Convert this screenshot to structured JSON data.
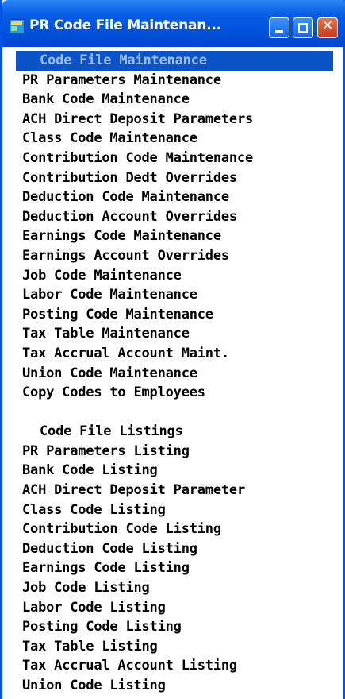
{
  "window": {
    "title": "PR Code File Maintenan...",
    "buttons": {
      "minimize": "minimize",
      "maximize": "maximize",
      "close": "✕"
    }
  },
  "menu": {
    "maintenance_header": "Code File Maintenance",
    "maintenance_items": [
      "PR Parameters Maintenance",
      "Bank Code Maintenance",
      "ACH Direct Deposit Parameters",
      "Class Code Maintenance",
      "Contribution Code Maintenance",
      "Contribution Dedt Overrides",
      "Deduction Code Maintenance",
      "Deduction Account Overrides",
      "Earnings Code Maintenance",
      "Earnings Account Overrides",
      "Job Code Maintenance",
      "Labor Code Maintenance",
      "Posting Code Maintenance",
      "Tax Table Maintenance",
      "Tax Accrual Account Maint.",
      "Union Code Maintenance",
      "Copy Codes to Employees"
    ],
    "listings_header": "Code File Listings",
    "listing_items": [
      "PR Parameters Listing",
      "Bank Code Listing",
      "ACH Direct Deposit Parameter",
      "Class Code Listing",
      "Contribution Code Listing",
      "Deduction Code Listing",
      "Earnings Code Listing",
      "Job Code Listing",
      "Labor Code Listing",
      "Posting Code Listing",
      "Tax Table Listing",
      "Tax Accrual Account Listing",
      "Union Code Listing"
    ]
  }
}
